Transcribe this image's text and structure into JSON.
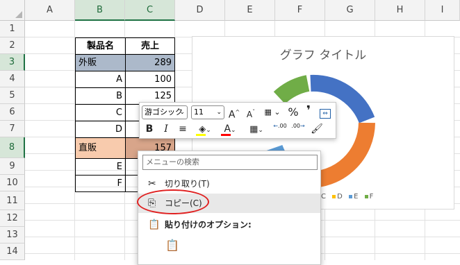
{
  "columns": [
    "A",
    "B",
    "C",
    "D",
    "E",
    "F",
    "G",
    "H",
    "I"
  ],
  "rows": [
    "1",
    "2",
    "3",
    "4",
    "5",
    "6",
    "7",
    "8",
    "9",
    "10",
    "11",
    "12",
    "13",
    "14"
  ],
  "table": {
    "header": {
      "name": "製品名",
      "sales": "売上"
    },
    "rows": [
      {
        "name": "外販",
        "value": "289"
      },
      {
        "name": "A",
        "value": "100"
      },
      {
        "name": "B",
        "value": "125"
      },
      {
        "name": "C",
        "value": ""
      },
      {
        "name": "D",
        "value": ""
      },
      {
        "name": "直販",
        "value": "157"
      },
      {
        "name": "E",
        "value": ""
      },
      {
        "name": "F",
        "value": ""
      }
    ]
  },
  "chart_data": {
    "type": "pie",
    "title": "グラフ タイトル",
    "legend": [
      {
        "label": "C",
        "color": "#F4B183"
      },
      {
        "label": "D",
        "color": "#FFC000"
      },
      {
        "label": "E",
        "color": "#5B9BD5"
      },
      {
        "label": "F",
        "color": "#70AD47"
      }
    ]
  },
  "mini_toolbar": {
    "font_name": "游ゴシック",
    "font_size": "11",
    "grow_font": "A",
    "shrink_font": "A",
    "percent": "%",
    "comma": "❜",
    "bold": "B",
    "italic": "I",
    "font_color_letter": "A",
    "decimal_increase": ".00",
    "decimal_decrease": ".00",
    "highlight_color": "#FFFF00",
    "font_color": "#FF0000"
  },
  "context_menu": {
    "search_placeholder": "メニューの検索",
    "items": [
      {
        "label": "切り取り(T)",
        "icon": "scissors-icon"
      },
      {
        "label": "コピー(C)",
        "icon": "copy-icon"
      },
      {
        "label": "貼り付けのオプション:",
        "icon": "paste-options-icon"
      }
    ]
  },
  "colors": {
    "accent_green": "#1F7244",
    "row3_fill": "#ACB9CA",
    "row8_fill": "#F8CBAD",
    "highlight_circle": "#E02020"
  }
}
